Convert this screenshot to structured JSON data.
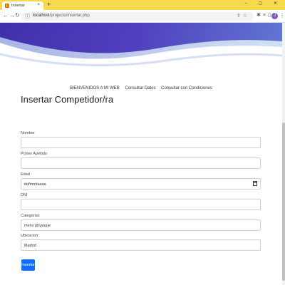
{
  "browser": {
    "tab_title": "Insertar",
    "new_tab": "+",
    "window_controls": "– ▢ ✕",
    "url_host": "localhost",
    "url_path": "/projecto/insertar.php",
    "avatar_initial": "J",
    "icons": [
      "back-icon",
      "forward-icon",
      "reload-icon",
      "info-icon",
      "share-icon",
      "star-icon",
      "extensions-icon",
      "media-icon",
      "sidebar-icon",
      "kebab-icon"
    ]
  },
  "colors": {
    "tabstrip": "#f7d94c",
    "wave_dark": "#3a2aa8",
    "wave_light": "#a6c3e8",
    "button": "#0d6efd"
  },
  "nav": {
    "items": [
      "BIENVENIDOS A MI WEB",
      "Consultar Datos",
      "Consultar con Condiciones"
    ]
  },
  "form": {
    "title": "Insertar Competidor/ra",
    "fields": [
      {
        "label": "Nombre",
        "value": ""
      },
      {
        "label": "Primer Apellido",
        "value": ""
      },
      {
        "label": "Edad",
        "value": "dd/mm/aaaa"
      },
      {
        "label": "DNI",
        "value": ""
      },
      {
        "label": "Categorias",
        "value": "mens physique"
      },
      {
        "label": "Ubicacion",
        "value": "Madrid"
      }
    ],
    "submit_label": "Insertar"
  }
}
